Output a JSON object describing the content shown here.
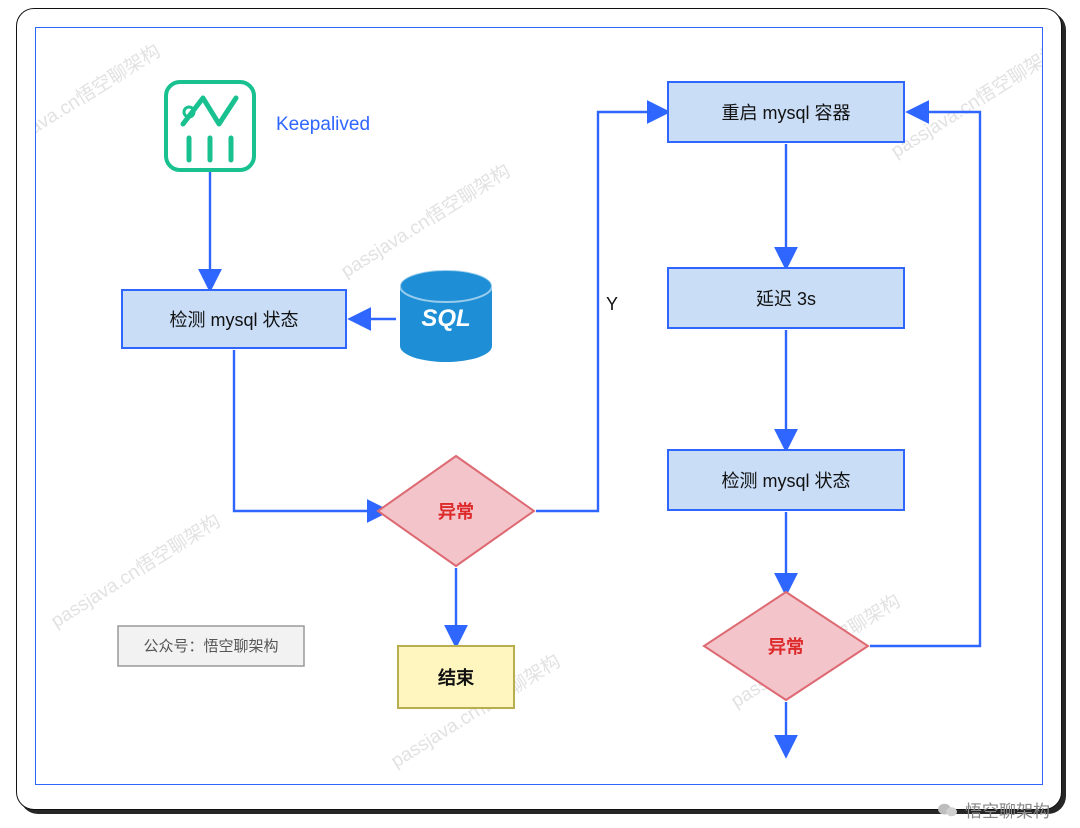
{
  "labels": {
    "keepalived": "Keepalived",
    "sql": "SQL",
    "check1": "检测 mysql 状态",
    "decision1": "异常",
    "end": "结束",
    "branchY": "Y",
    "restart": "重启 mysql 容器",
    "delay": "延迟 3s",
    "check2": "检测 mysql 状态",
    "decision2": "异常",
    "credit": "公众号：悟空聊架构",
    "watermark": "passjava.cn悟空聊架构",
    "footer": "悟空聊架构"
  },
  "colors": {
    "blueStroke": "#2f66ff",
    "blueFill": "#c9ddf7",
    "pinkFill": "#f4c4cb",
    "yellowFill": "#fff6bf",
    "greyFill": "#f2f2f2",
    "green": "#18c18f",
    "sqlBlue": "#1e8fd6",
    "red": "#dd2a2a"
  }
}
